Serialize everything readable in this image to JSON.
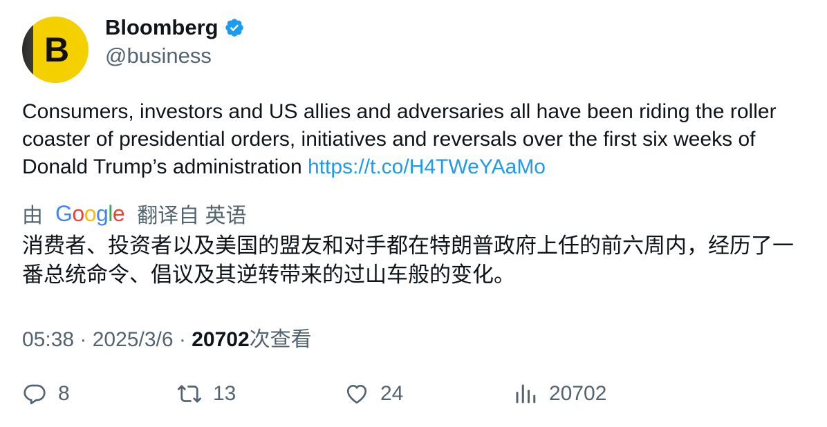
{
  "author": {
    "display_name": "Bloomberg",
    "handle": "@business",
    "avatar_letter": "B",
    "verified": true,
    "avatar_color": "#f5d000"
  },
  "tweet": {
    "text": "Consumers, investors and US allies and adversaries all have been riding the roller coaster of presidential orders, initiatives and reversals over the first six weeks of Donald Trump’s administration ",
    "link": "https://t.co/H4TWeYAaMo"
  },
  "translation": {
    "by_label": "由",
    "provider": "Google",
    "from_label": "翻译自 英语",
    "text": "消费者、投资者以及美国的盟友和对手都在特朗普政府上任的前六周内，经历了一番总统命令、倡议及其逆转带来的过山车般的变化。"
  },
  "meta": {
    "time": "05:38",
    "separator": " · ",
    "date": "2025/3/6",
    "views_count": "20702",
    "views_label": "次查看"
  },
  "actions": {
    "replies": "8",
    "retweets": "13",
    "likes": "24",
    "views": "20702"
  },
  "colors": {
    "link": "#1d9bf0",
    "secondary_text": "#536471",
    "primary_text": "#0f1419",
    "verified_badge": "#1d9bf0"
  },
  "icons": [
    "verified-badge-icon",
    "reply-icon",
    "retweet-icon",
    "like-icon",
    "views-icon"
  ]
}
